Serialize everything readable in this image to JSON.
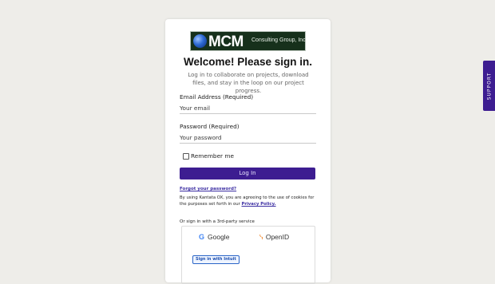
{
  "logo": {
    "name": "MCM",
    "subtitle": "Consulting Group, Inc."
  },
  "login": {
    "title": "Welcome! Please sign in.",
    "subtitle": "Log in to collaborate on projects, download files, and stay in the loop on our project progress.",
    "email_label": "Email Address (Required)",
    "email_placeholder": "Your email",
    "password_label": "Password (Required)",
    "password_placeholder": "Your password",
    "remember_label": "Remember me",
    "login_button": "Log In",
    "forgot_link": "Forgot your password?",
    "cookie_text": "By using Kantata OX, you are agreeing to the use of cookies for the purposes set forth in our",
    "privacy_link": "Privacy Policy.",
    "third_party_label": "Or sign in with a 3rd-party service"
  },
  "providers": {
    "google": "Google",
    "openid": "OpenID",
    "intuit": "Sign in with Intuit"
  },
  "support_tab": "SUPPORT",
  "colors": {
    "background": "#eeede9",
    "accent": "#3d1d91",
    "link": "#3d2fa3"
  },
  "icons": [
    "logo-globe-icon",
    "google-icon",
    "openid-icon"
  ]
}
